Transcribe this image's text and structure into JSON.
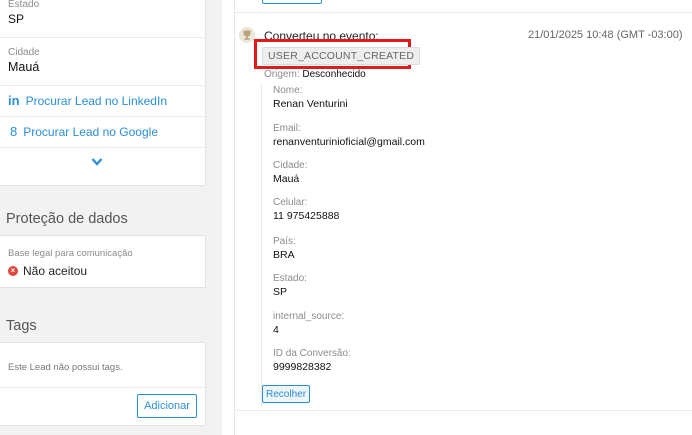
{
  "lead": {
    "estado_label": "Estado",
    "estado_value": "SP",
    "cidade_label": "Cidade",
    "cidade_value": "Mauá",
    "linkedin_link": "Procurar Lead no LinkedIn",
    "google_link": "Procurar Lead no Google"
  },
  "privacy": {
    "title": "Proteção de dados",
    "basis_label": "Base legal para comunicação",
    "basis_value": "Não aceitou"
  },
  "tags": {
    "title": "Tags",
    "empty_text": "Este Lead não possui tags.",
    "add_button": "Adicionar"
  },
  "event": {
    "title": "Converteu no evento:",
    "timestamp": "21/01/2025 10:48 (GMT -03:00)",
    "event_name": "USER_ACCOUNT_CREATED",
    "origin_label": "Origem:",
    "origin_value": "Desconhecido",
    "fields": [
      {
        "label": "Nome:",
        "value": "Renan Venturini"
      },
      {
        "label": "Email:",
        "value": "renanventurinioficial@gmail.com"
      },
      {
        "label": "Cidade:",
        "value": "Mauá"
      },
      {
        "label": "Celular:",
        "value": "11 975425888"
      },
      {
        "label": "País:",
        "value": "BRA"
      },
      {
        "label": "Estado:",
        "value": "SP"
      },
      {
        "label": "internal_source:",
        "value": "4"
      },
      {
        "label": "ID da Conversão:",
        "value": "9999828382"
      }
    ],
    "collapse_button": "Recolher"
  },
  "colors": {
    "link": "#2b8fd6",
    "highlight": "#e01b1b",
    "error": "#e0443c",
    "trophy": "#b8a37a"
  }
}
